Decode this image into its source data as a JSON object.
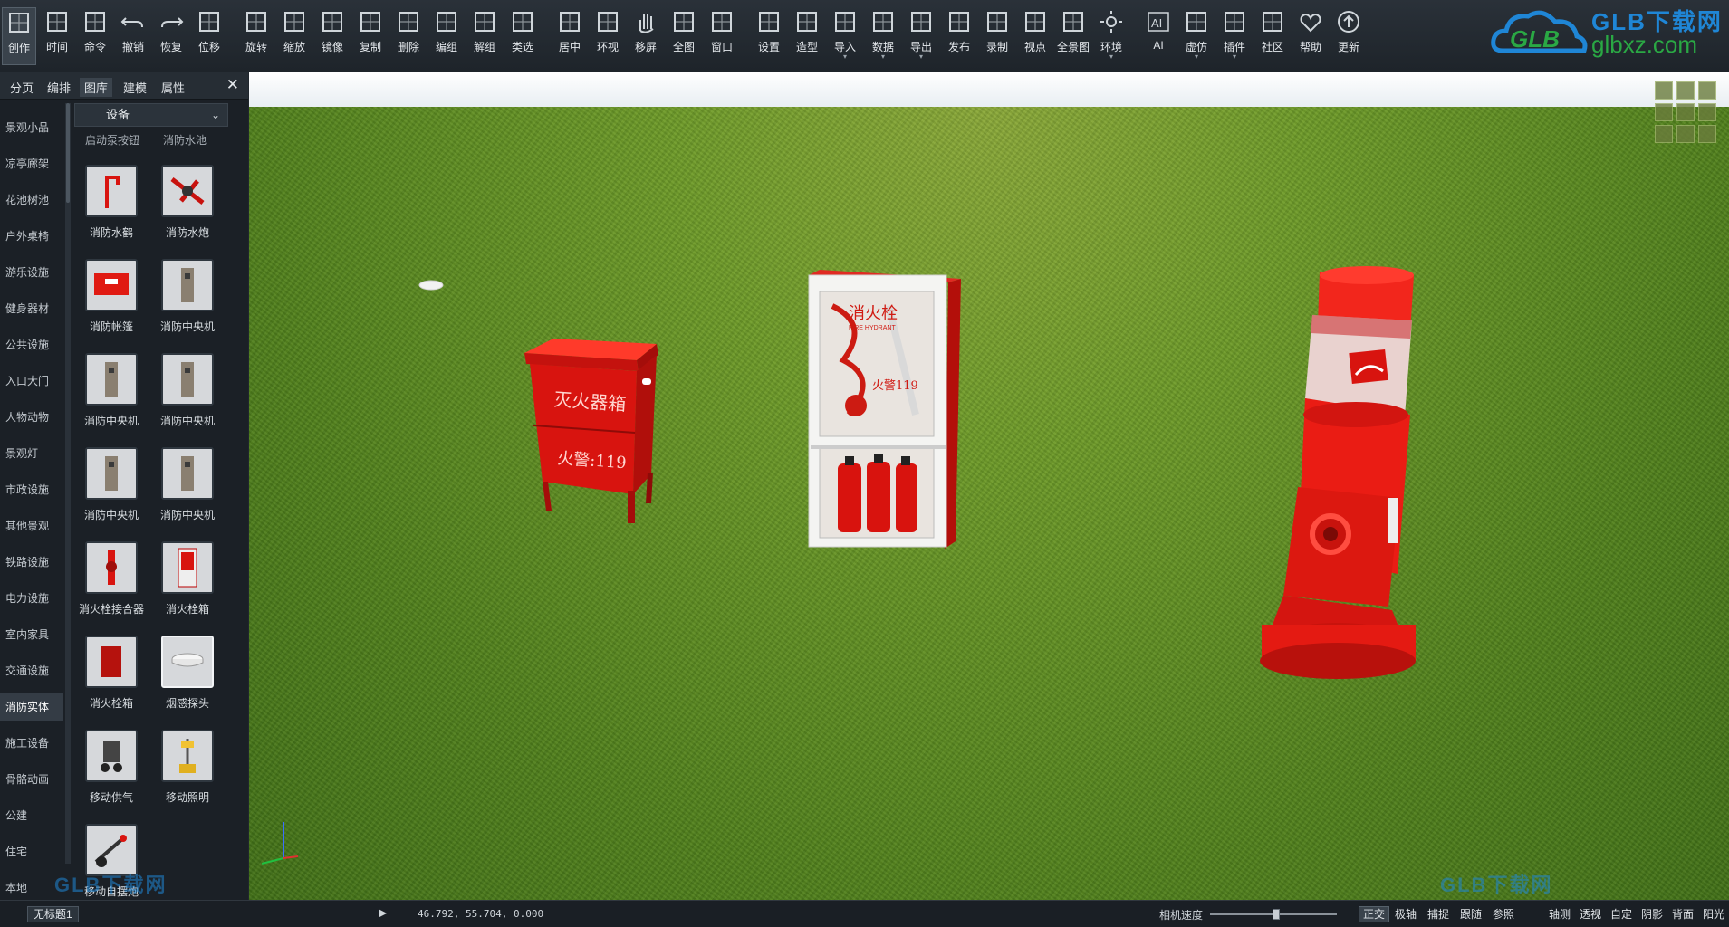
{
  "toolbar": {
    "tools": [
      {
        "id": "create",
        "label": "创作",
        "icon": "create-icon"
      },
      {
        "id": "timeline",
        "label": "时间",
        "icon": "timeline-icon"
      },
      {
        "id": "command",
        "label": "命令",
        "icon": "command-icon"
      },
      {
        "id": "undo",
        "label": "撤销",
        "icon": "undo-icon"
      },
      {
        "id": "redo",
        "label": "恢复",
        "icon": "redo-icon"
      },
      {
        "id": "move",
        "label": "位移",
        "icon": "move-icon"
      },
      {
        "id": "rotate",
        "label": "旋转",
        "icon": "rotate-icon"
      },
      {
        "id": "scale",
        "label": "缩放",
        "icon": "scale-icon"
      },
      {
        "id": "mirror",
        "label": "镜像",
        "icon": "mirror-icon"
      },
      {
        "id": "copy",
        "label": "复制",
        "icon": "copy-icon"
      },
      {
        "id": "delete",
        "label": "删除",
        "icon": "delete-icon"
      },
      {
        "id": "group",
        "label": "编组",
        "icon": "group-icon"
      },
      {
        "id": "ungroup",
        "label": "解组",
        "icon": "ungroup-icon"
      },
      {
        "id": "select-type",
        "label": "类选",
        "icon": "select-type-icon"
      },
      {
        "id": "center",
        "label": "居中",
        "icon": "center-icon"
      },
      {
        "id": "orbit",
        "label": "环视",
        "icon": "orbit-icon"
      },
      {
        "id": "pan",
        "label": "移屏",
        "icon": "hand-icon"
      },
      {
        "id": "full",
        "label": "全图",
        "icon": "fullview-icon"
      },
      {
        "id": "window",
        "label": "窗口",
        "icon": "window-icon"
      },
      {
        "id": "settings",
        "label": "设置",
        "icon": "settings-icon"
      },
      {
        "id": "shape",
        "label": "造型",
        "icon": "shape-icon"
      },
      {
        "id": "import",
        "label": "导入",
        "icon": "import-icon",
        "caret": true
      },
      {
        "id": "data",
        "label": "数据",
        "icon": "data-icon",
        "caret": true
      },
      {
        "id": "export",
        "label": "导出",
        "icon": "export-icon",
        "caret": true
      },
      {
        "id": "publish",
        "label": "发布",
        "icon": "publish-icon"
      },
      {
        "id": "record",
        "label": "录制",
        "icon": "record-icon"
      },
      {
        "id": "viewpoint",
        "label": "视点",
        "icon": "viewpoint-icon"
      },
      {
        "id": "panorama",
        "label": "全景图",
        "icon": "panorama-icon"
      },
      {
        "id": "environment",
        "label": "环境",
        "icon": "sun-icon",
        "caret": true
      },
      {
        "id": "ai",
        "label": "AI",
        "icon": "ai-icon"
      },
      {
        "id": "simulation",
        "label": "虚仿",
        "icon": "vr-icon",
        "caret": true
      },
      {
        "id": "plugin",
        "label": "插件",
        "icon": "plugin-icon",
        "caret": true
      },
      {
        "id": "community",
        "label": "社区",
        "icon": "community-icon"
      },
      {
        "id": "help",
        "label": "帮助",
        "icon": "help-icon"
      },
      {
        "id": "update",
        "label": "更新",
        "icon": "update-icon"
      }
    ]
  },
  "logo": {
    "brand": "GLB下载网",
    "url": "glbxz.com",
    "mark": "GLB"
  },
  "panel": {
    "tabs": [
      "分页",
      "编排",
      "图库",
      "建模",
      "属性"
    ],
    "active_tab": "图库",
    "close": "✕",
    "categories": [
      "景观小品",
      "凉亭廊架",
      "花池树池",
      "户外桌椅",
      "游乐设施",
      "健身器材",
      "公共设施",
      "入口大门",
      "人物动物",
      "景观灯",
      "市政设施",
      "其他景观",
      "铁路设施",
      "电力设施",
      "室内家具",
      "交通设施",
      "消防实体",
      "施工设备",
      "骨骼动画",
      "公建",
      "住宅",
      "本地"
    ],
    "active_category": "消防实体",
    "dropdown": "设备",
    "partial_items": [
      "启动泵按钮",
      "消防水池"
    ],
    "items": [
      {
        "name": "消防水鹤",
        "kind": "crane"
      },
      {
        "name": "消防水炮",
        "kind": "cannon"
      },
      {
        "name": "消防帐篷",
        "kind": "tent"
      },
      {
        "name": "消防中央机",
        "kind": "cabinet"
      },
      {
        "name": "消防中央机",
        "kind": "cabinet"
      },
      {
        "name": "消防中央机",
        "kind": "cabinet"
      },
      {
        "name": "消防中央机",
        "kind": "cabinet"
      },
      {
        "name": "消防中央机",
        "kind": "cabinet"
      },
      {
        "name": "消火栓接合器",
        "kind": "connector"
      },
      {
        "name": "消火栓箱",
        "kind": "hydrant-box"
      },
      {
        "name": "消火栓箱",
        "kind": "red-box"
      },
      {
        "name": "烟感探头",
        "kind": "smoke",
        "selected": true
      },
      {
        "name": "移动供气",
        "kind": "supply"
      },
      {
        "name": "移动照明",
        "kind": "light"
      },
      {
        "name": "移动自摆炮",
        "kind": "mobile-cannon"
      }
    ]
  },
  "viewport": {
    "objects": {
      "extinguisher_box_front": "灭火器箱",
      "extinguisher_box_phone": "火警:119",
      "hydrant_cabinet_title": "消火栓",
      "hydrant_cabinet_sub": "FIRE HYDRANT",
      "hydrant_cabinet_phone": "火警119"
    }
  },
  "status": {
    "file": "无标题1",
    "play": "▶",
    "coords": "46.792, 55.704, 0.000",
    "camera_speed_label": "相机速度",
    "camera_speed": 0.52,
    "buttons": [
      {
        "label": "正交",
        "on": true
      },
      {
        "label": "极轴",
        "on": false
      },
      {
        "label": "捕捉",
        "on": false
      },
      {
        "label": "跟随",
        "on": false
      },
      {
        "label": "参照",
        "on": false
      },
      {
        "label": "轴测",
        "on": false
      },
      {
        "label": "透视",
        "on": false
      },
      {
        "label": "自定",
        "on": false
      },
      {
        "label": "阴影",
        "on": false
      },
      {
        "label": "背面",
        "on": false
      },
      {
        "label": "阳光",
        "on": false
      }
    ]
  },
  "colors": {
    "accent_red": "#e01a1a",
    "grass": "#5c8a22",
    "panel_bg": "#1b2026",
    "brand_blue": "#1f86d6",
    "brand_green": "#2aa844"
  }
}
